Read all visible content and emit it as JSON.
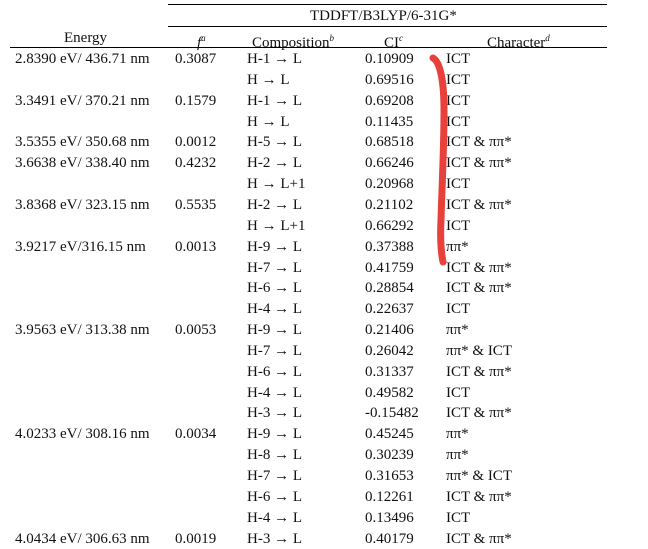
{
  "table": {
    "group_header": "TDDFT/B3LYP/6-31G*",
    "columns": [
      {
        "label": "Energy",
        "sup": ""
      },
      {
        "label": "f",
        "sup": "a"
      },
      {
        "label": "Composition",
        "sup": "b"
      },
      {
        "label": "CI",
        "sup": "c"
      },
      {
        "label": "Character",
        "sup": "d"
      }
    ],
    "rows": [
      {
        "energy": "2.8390 eV/ 436.71 nm",
        "f": "0.3087",
        "comp": "H-1 → L",
        "ci": "0.10909",
        "char": "ICT"
      },
      {
        "energy": "",
        "f": "",
        "comp": "H → L",
        "ci": "0.69516",
        "char": "ICT"
      },
      {
        "energy": "3.3491 eV/ 370.21 nm",
        "f": "0.1579",
        "comp": "H-1 → L",
        "ci": "0.69208",
        "char": "ICT"
      },
      {
        "energy": "",
        "f": "",
        "comp": "H → L",
        "ci": "0.11435",
        "char": "ICT"
      },
      {
        "energy": "3.5355 eV/ 350.68 nm",
        "f": "0.0012",
        "comp": "H-5 → L",
        "ci": "0.68518",
        "char": "ICT & ππ*"
      },
      {
        "energy": "3.6638 eV/ 338.40 nm",
        "f": "0.4232",
        "comp": "H-2 → L",
        "ci": "0.66246",
        "char": "ICT & ππ*"
      },
      {
        "energy": "",
        "f": "",
        "comp": "H → L+1",
        "ci": "0.20968",
        "char": "ICT"
      },
      {
        "energy": "3.8368 eV/ 323.15 nm",
        "f": "0.5535",
        "comp": "H-2 → L",
        "ci": "0.21102",
        "char": "ICT & ππ*"
      },
      {
        "energy": "",
        "f": "",
        "comp": "H → L+1",
        "ci": "0.66292",
        "char": "ICT"
      },
      {
        "energy": "3.9217 eV/316.15 nm",
        "f": "0.0013",
        "comp": "H-9 → L",
        "ci": "0.37388",
        "char": "ππ*"
      },
      {
        "energy": "",
        "f": "",
        "comp": "H-7 → L",
        "ci": "0.41759",
        "char": "ICT & ππ*"
      },
      {
        "energy": "",
        "f": "",
        "comp": "H-6 → L",
        "ci": "0.28854",
        "char": "ICT & ππ*"
      },
      {
        "energy": "",
        "f": "",
        "comp": "H-4 → L",
        "ci": "0.22637",
        "char": "ICT"
      },
      {
        "energy": "3.9563 eV/ 313.38 nm",
        "f": "0.0053",
        "comp": "H-9 → L",
        "ci": "0.21406",
        "char": "ππ*"
      },
      {
        "energy": "",
        "f": "",
        "comp": "H-7 → L",
        "ci": "0.26042",
        "char": "ππ* & ICT"
      },
      {
        "energy": "",
        "f": "",
        "comp": "H-6 → L",
        "ci": "0.31337",
        "char": "ICT & ππ*"
      },
      {
        "energy": "",
        "f": "",
        "comp": "H-4 → L",
        "ci": "0.49582",
        "char": "ICT"
      },
      {
        "energy": "",
        "f": "",
        "comp": "H-3 → L",
        "ci": "-0.15482",
        "char": "ICT & ππ*"
      },
      {
        "energy": "4.0233 eV/ 308.16 nm",
        "f": "0.0034",
        "comp": "H-9 → L",
        "ci": "0.45245",
        "char": "ππ*"
      },
      {
        "energy": "",
        "f": "",
        "comp": "H-8 → L",
        "ci": "0.30239",
        "char": "ππ*"
      },
      {
        "energy": "",
        "f": "",
        "comp": "H-7 → L",
        "ci": "0.31653",
        "char": "ππ* & ICT"
      },
      {
        "energy": "",
        "f": "",
        "comp": "H-6 → L",
        "ci": "0.12261",
        "char": "ICT & ππ*"
      },
      {
        "energy": "",
        "f": "",
        "comp": "H-4 → L",
        "ci": "0.13496",
        "char": "ICT"
      },
      {
        "energy": "4.0434 eV/ 306.63 nm",
        "f": "0.0019",
        "comp": "H-3 → L",
        "ci": "0.40179",
        "char": "ICT & ππ*"
      }
    ]
  },
  "annotation": {
    "color": "#e8403a"
  }
}
